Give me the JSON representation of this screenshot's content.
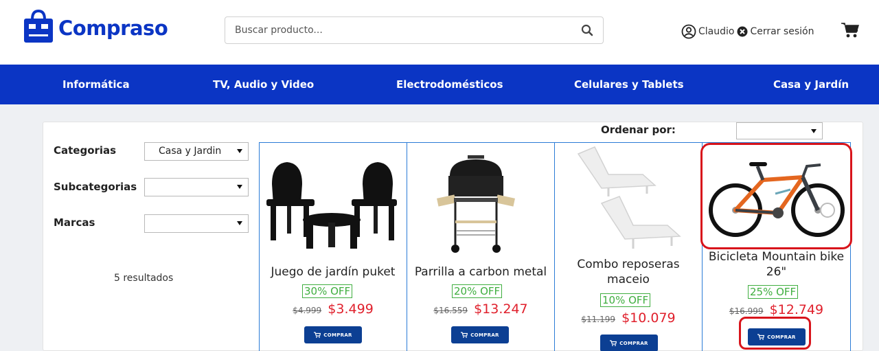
{
  "header": {
    "brand": "Compraso",
    "brand_color": "#0b35c4",
    "search": {
      "placeholder": "Buscar producto...",
      "icon": "search-icon"
    },
    "user": {
      "name": "Claudio",
      "icon": "user-circle-icon"
    },
    "logout": {
      "label": "Cerrar sesión",
      "icon": "close-circle-icon"
    },
    "cart": {
      "icon": "cart-icon"
    }
  },
  "nav": {
    "items": [
      {
        "label": "Informática"
      },
      {
        "label": "TV, Audio y Video"
      },
      {
        "label": "Electrodomésticos"
      },
      {
        "label": "Celulares y Tablets"
      },
      {
        "label": "Casa y Jardín"
      }
    ]
  },
  "sort": {
    "label": "Ordenar por:",
    "value": ""
  },
  "filters": {
    "categories": {
      "label": "Categorias",
      "value": "Casa y Jardin"
    },
    "subcategories": {
      "label": "Subcategorias",
      "value": ""
    },
    "brands": {
      "label": "Marcas",
      "value": ""
    },
    "results": "5 resultados"
  },
  "products": [
    {
      "title": "Juego de jardín puket",
      "discount": "30% OFF",
      "old_price": "$4.999",
      "price": "$3.499",
      "buy_label": "COMPRAR",
      "image": "garden-chairs-image"
    },
    {
      "title": "Parrilla a carbon metal",
      "discount": "20% OFF",
      "old_price": "$16.559",
      "price": "$13.247",
      "buy_label": "COMPRAR",
      "image": "charcoal-grill-image"
    },
    {
      "title": "Combo reposeras maceio",
      "discount": "10% OFF",
      "old_price": "$11.199",
      "price": "$10.079",
      "buy_label": "COMPRAR",
      "image": "sun-loungers-image"
    },
    {
      "title": "Bicicleta Mountain bike 26\"",
      "discount": "25% OFF",
      "old_price": "$16.999",
      "price": "$12.749",
      "buy_label": "COMPRAR",
      "image": "mountain-bike-image"
    }
  ],
  "colors": {
    "nav_bg": "#0b35c4",
    "grid_border": "#2a7bd6",
    "discount": "#3fae3f",
    "price": "#e0202c",
    "buy_button": "#0c3f93",
    "highlight": "#d8141b"
  }
}
